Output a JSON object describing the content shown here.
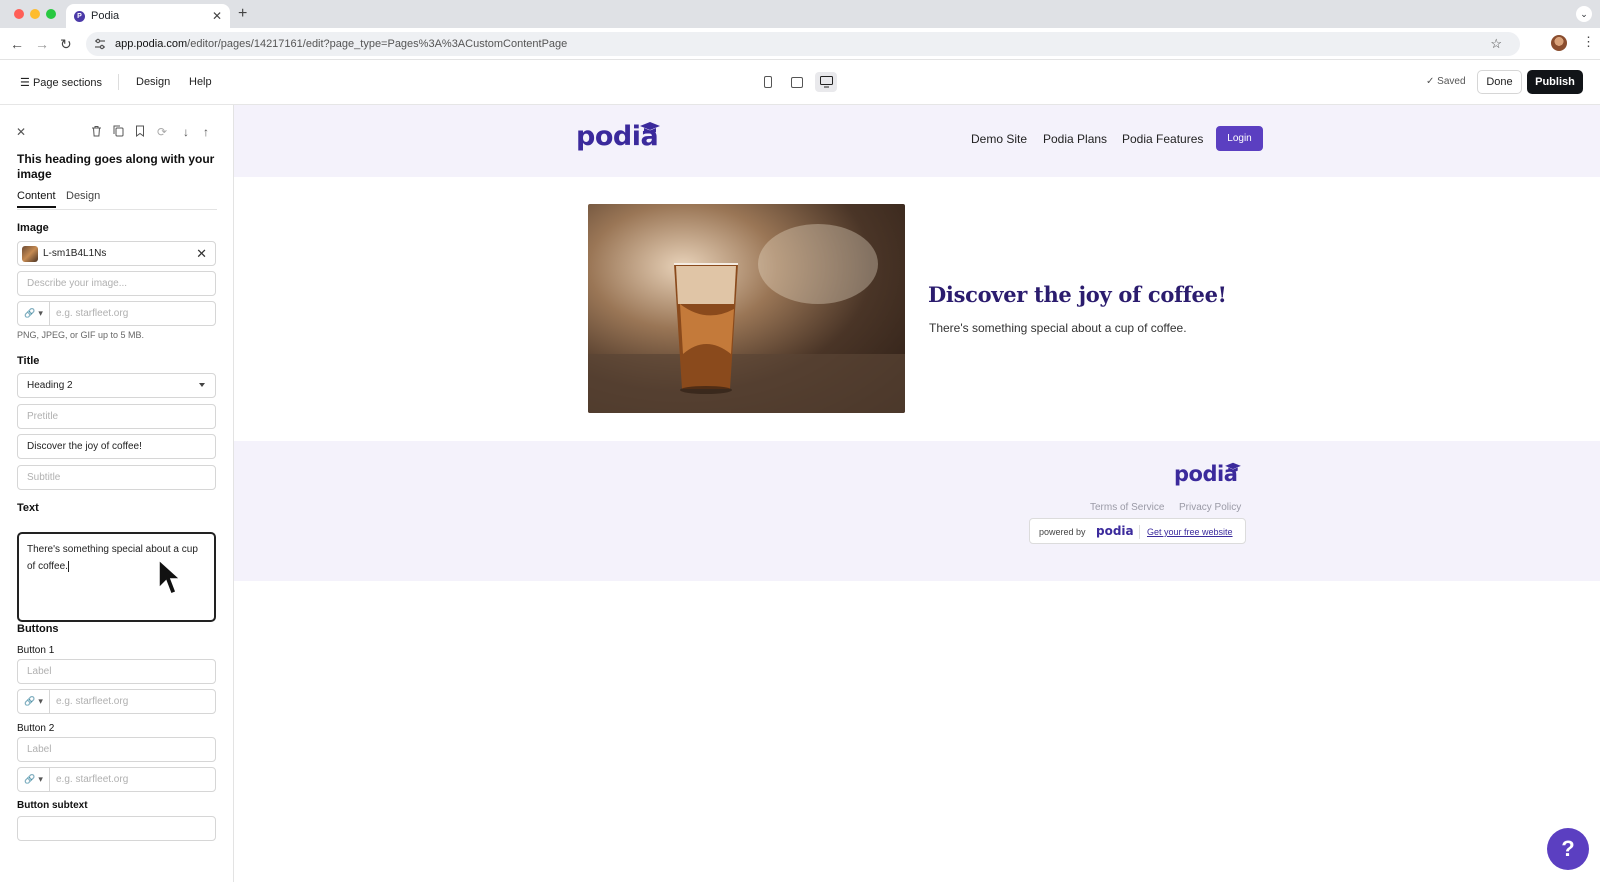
{
  "browser": {
    "tab_title": "Podia",
    "new_tab": "+",
    "url_host": "app.podia.com",
    "url_path": "/editor/pages/14217161/edit?page_type=Pages%3A%3ACustomContentPage"
  },
  "toolbar": {
    "page_sections": "Page sections",
    "design": "Design",
    "help": "Help",
    "saved": "Saved",
    "done": "Done",
    "publish": "Publish"
  },
  "sidebar": {
    "heading": "This heading goes along with your image",
    "tabs": [
      "Content",
      "Design"
    ],
    "image": {
      "label": "Image",
      "filename": "L-sm1B4L1Ns",
      "alt_placeholder": "Describe your image...",
      "link_placeholder": "e.g. starfleet.org",
      "hint": "PNG, JPEG, or GIF up to 5 MB."
    },
    "title": {
      "label": "Title",
      "level": "Heading 2",
      "pretitle_placeholder": "Pretitle",
      "value": "Discover the joy of coffee!",
      "subtitle_placeholder": "Subtitle"
    },
    "text": {
      "label": "Text",
      "value": "There's something special about a cup of coffee."
    },
    "buttons": {
      "label": "Buttons",
      "button1_label": "Button 1",
      "button2_label": "Button 2",
      "label_placeholder": "Label",
      "link_placeholder": "e.g. starfleet.org",
      "subtext_label": "Button subtext"
    }
  },
  "preview": {
    "logo": "podia",
    "nav": [
      "Demo Site",
      "Podia Plans",
      "Podia Features"
    ],
    "login": "Login",
    "hero_title": "Discover the joy of coffee!",
    "hero_text": "There's something special about a cup of coffee.",
    "footer": {
      "logo": "podia",
      "terms": "Terms of Service",
      "privacy": "Privacy Policy",
      "powered_by": "powered by",
      "powered_logo": "podia",
      "free_site": "Get your free website"
    }
  },
  "help_fab": "?",
  "colors": {
    "brand": "#3b2a9c",
    "accent": "#5b3fc1",
    "header_bg": "#f4f2fb",
    "publish_bg": "#111418"
  },
  "icons": {
    "close": "close-icon",
    "trash": "trash-icon",
    "duplicate": "duplicate-icon",
    "bookmark": "bookmark-icon",
    "refresh": "refresh-icon",
    "move_down": "arrow-down-icon",
    "move_up": "arrow-up-icon",
    "link": "link-icon",
    "hamburger": "menu-icon",
    "check": "check-icon"
  }
}
